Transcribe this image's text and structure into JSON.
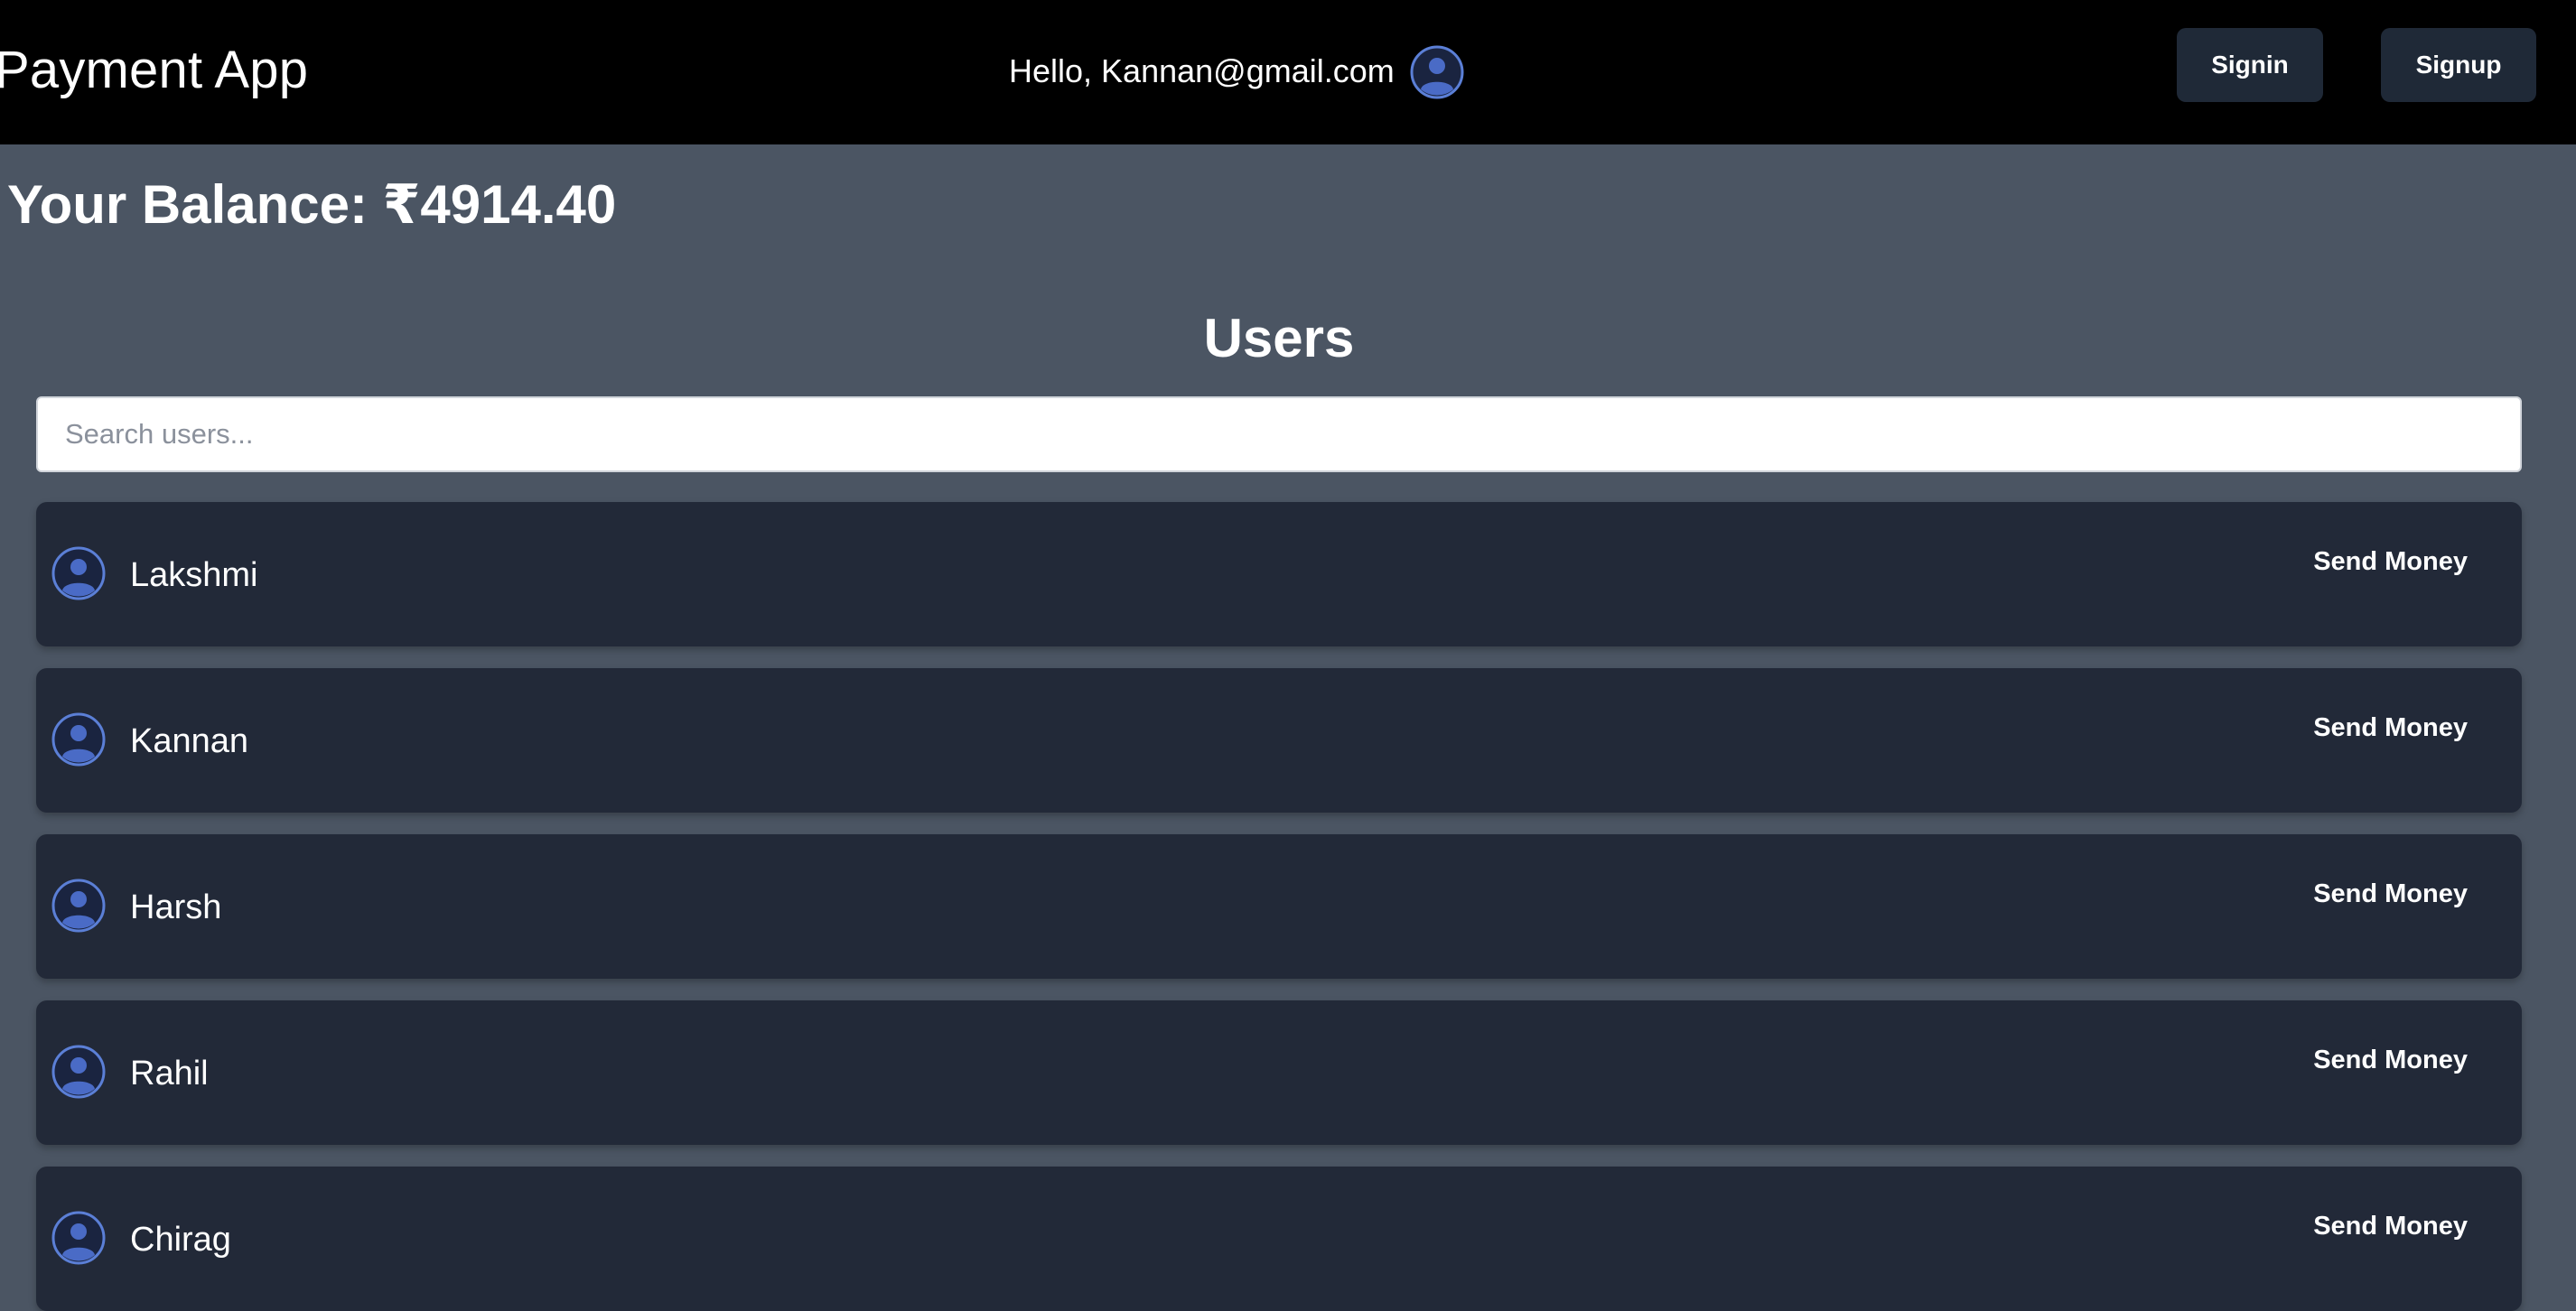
{
  "header": {
    "brand": "Payment App",
    "greeting": "Hello, Kannan@gmail.com",
    "avatar_icon": "user-avatar-icon",
    "signin_label": "Signin",
    "signup_label": "Signup"
  },
  "balance": {
    "text": "Your Balance: ₹4914.40"
  },
  "users": {
    "title": "Users",
    "search_placeholder": "Search users...",
    "send_label": "Send Money",
    "items": [
      {
        "name": "Lakshmi"
      },
      {
        "name": "Kannan"
      },
      {
        "name": "Harsh"
      },
      {
        "name": "Rahil"
      },
      {
        "name": "Chirag"
      }
    ]
  },
  "colors": {
    "header_bg": "#000000",
    "page_bg": "#4b5563",
    "card_bg": "#222938",
    "button_bg": "#1f2937",
    "avatar_accent": "#4a6bc6"
  }
}
